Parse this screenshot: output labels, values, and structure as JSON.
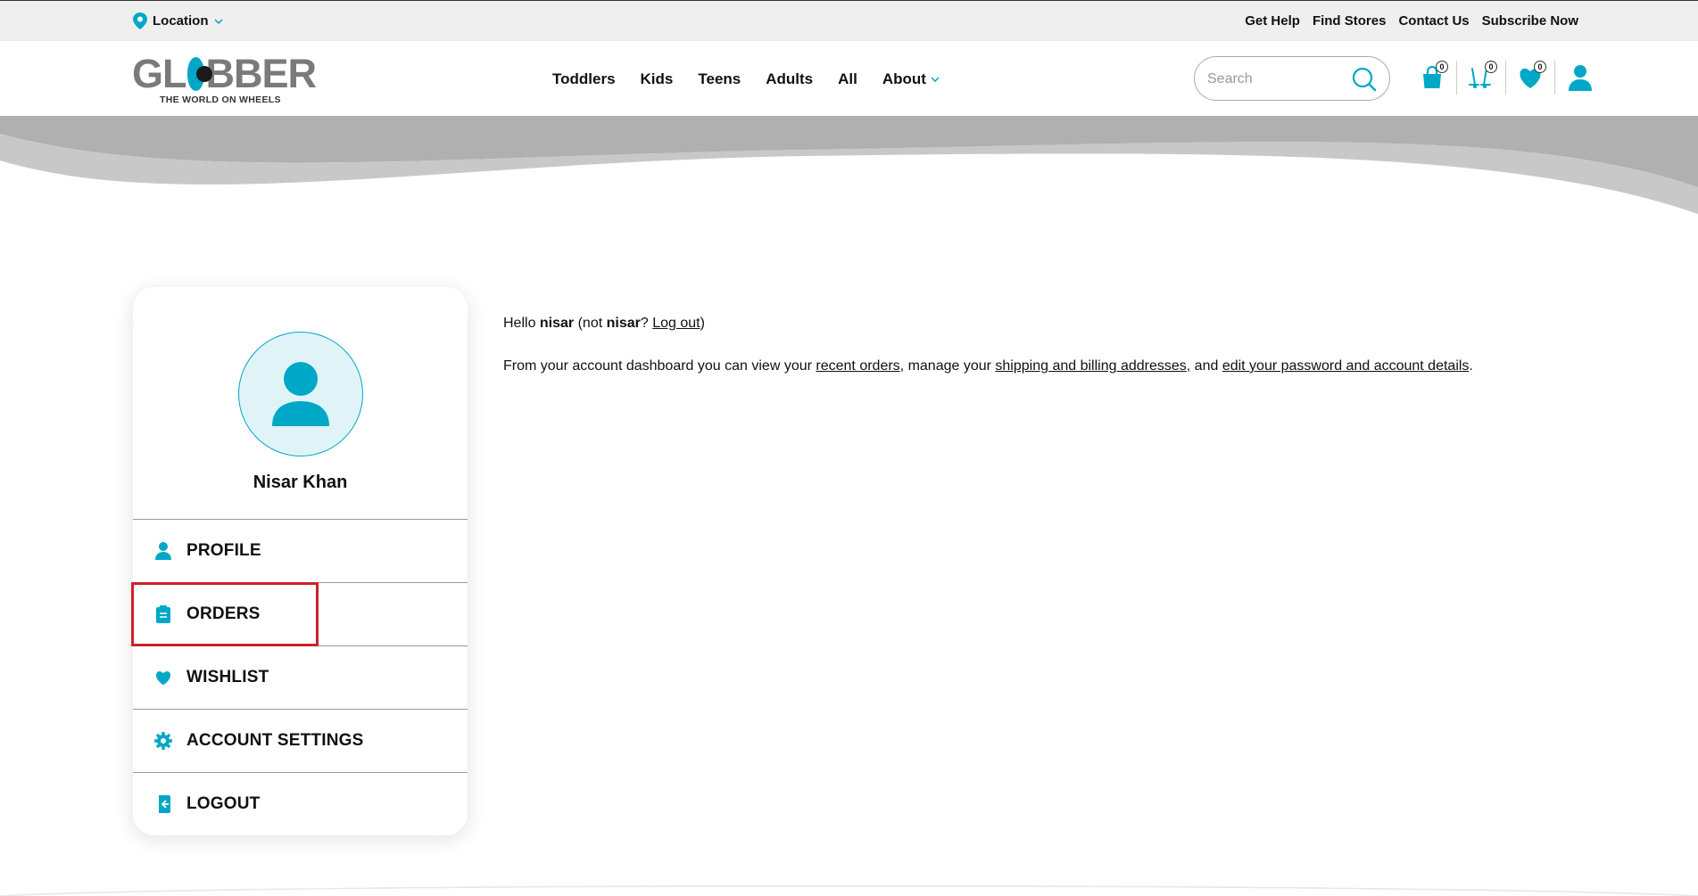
{
  "topbar": {
    "location_label": "Location",
    "links": [
      "Get Help",
      "Find Stores",
      "Contact Us",
      "Subscribe Now"
    ]
  },
  "header": {
    "logo_text": "GLOBBER",
    "logo_tagline": "THE WORLD ON WHEELS",
    "nav": [
      "Toddlers",
      "Kids",
      "Teens",
      "Adults",
      "All",
      "About"
    ],
    "search_placeholder": "Search",
    "icons": [
      {
        "name": "cart-icon",
        "count": "0"
      },
      {
        "name": "compare-icon",
        "count": "0"
      },
      {
        "name": "wishlist-icon",
        "count": "0"
      }
    ]
  },
  "account": {
    "user_name": "Nisar Khan",
    "menu": [
      "PROFILE",
      "ORDERS",
      "WISHLIST",
      "ACCOUNT SETTINGS",
      "LOGOUT"
    ]
  },
  "dashboard": {
    "hello": "Hello ",
    "username": "nisar",
    "not_open": " (not ",
    "not_user": "nisar",
    "q": "? ",
    "logout_link": "Log out",
    "close": ")",
    "desc_1": "From your account dashboard you can view your ",
    "recent_orders": "recent orders",
    "desc_2": ", manage your ",
    "addresses": "shipping and billing addresses",
    "desc_3": ", and ",
    "account_details": "edit your password and account details",
    "desc_4": "."
  },
  "colors": {
    "accent": "#00a7c7",
    "highlight": "#d0202a",
    "topbar_bg": "#efefef"
  }
}
